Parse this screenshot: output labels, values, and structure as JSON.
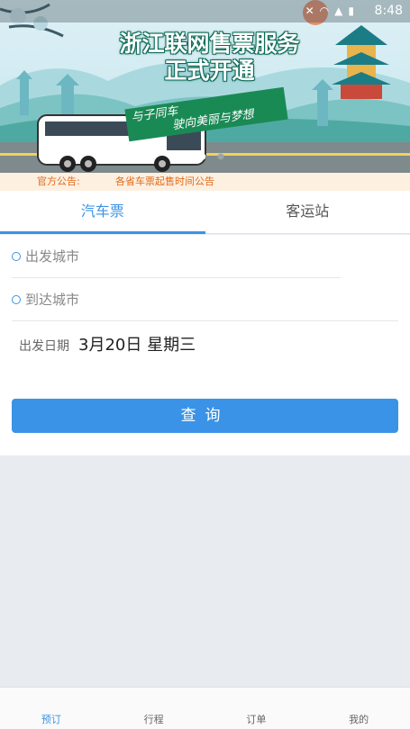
{
  "status_bar": {
    "time": "8:48"
  },
  "banner": {
    "title_line1": "浙江联网售票服务",
    "title_line2": "正式开通",
    "slogan_line1": "与子同车",
    "slogan_line2": "驶向美丽与梦想"
  },
  "notice": {
    "label": "官方公告:",
    "message": "各省车票起售时间公告"
  },
  "tabs": [
    {
      "label": "汽车票",
      "active": true
    },
    {
      "label": "客运站",
      "active": false
    }
  ],
  "form": {
    "from_placeholder": "出发城市",
    "to_placeholder": "到达城市",
    "date_label": "出发日期",
    "date_value": "3月20日 星期三",
    "search_label": "查询"
  },
  "bottom_nav": [
    {
      "label": "预订",
      "active": true
    },
    {
      "label": "行程",
      "active": false
    },
    {
      "label": "订单",
      "active": false
    },
    {
      "label": "我的",
      "active": false
    }
  ],
  "colors": {
    "accent": "#3a93e6",
    "notice_text": "#e26a1c",
    "notice_bg": "#fdf0e1"
  }
}
